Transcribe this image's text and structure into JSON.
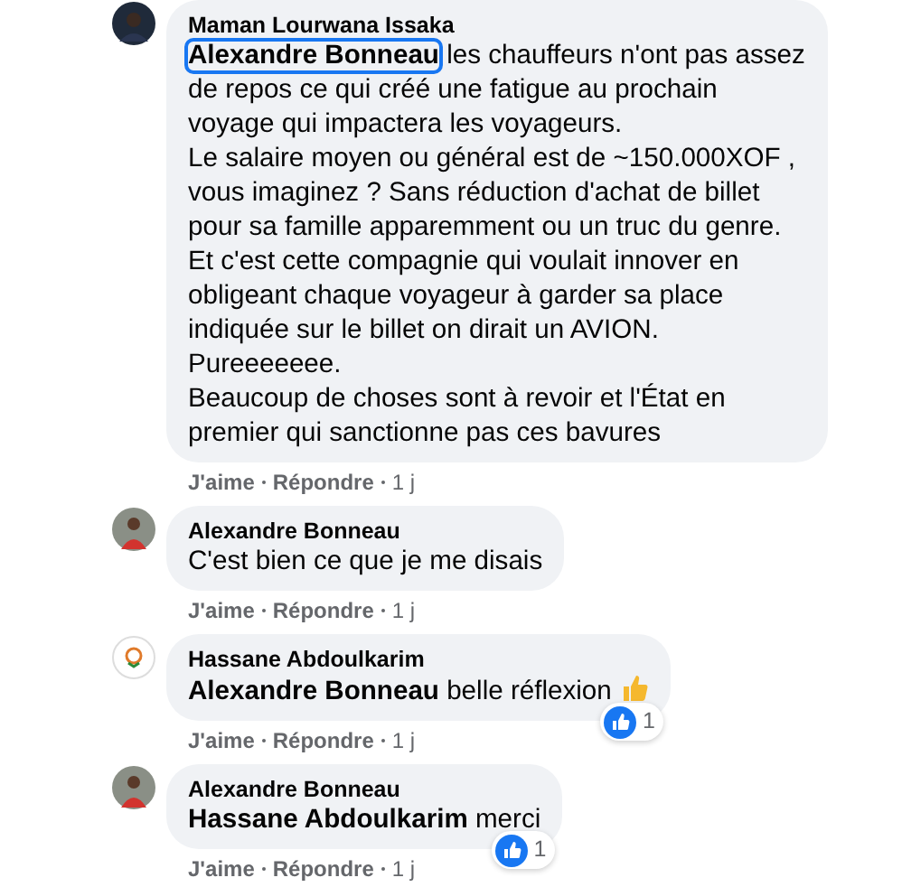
{
  "comments": [
    {
      "author": "Maman Lourwana Issaka",
      "avatar": {
        "kind": "dark"
      },
      "mention": "Alexandre Bonneau",
      "mention_focused": true,
      "text": " les chauffeurs n'ont pas assez de repos ce qui créé une fatigue au prochain voyage qui impactera les voyageurs.\nLe salaire moyen ou général est de ~150.000XOF , vous imaginez ? Sans réduction d'achat de billet pour sa famille apparemment ou un truc du genre.\nEt c'est cette compagnie qui voulait innover en obligeant chaque voyageur à garder sa place indiquée sur le billet on dirait un AVION.\nPureeeeeee.\nBeaucoup de choses sont à revoir et l'État en premier qui sanctionne pas ces bavures",
      "actions": [
        "J'aime",
        "Répondre",
        "1 j"
      ]
    },
    {
      "author": "Alexandre Bonneau",
      "avatar": {
        "kind": "red"
      },
      "text": "C'est bien ce que je me disais",
      "actions": [
        "J'aime",
        "Répondre",
        "1 j"
      ]
    },
    {
      "author": "Hassane Abdoulkarim",
      "avatar": {
        "kind": "logo"
      },
      "mention": "Alexandre Bonneau",
      "mention_focused": false,
      "text": " belle réflexion",
      "emoji": {
        "kind": "thumbs-up"
      },
      "reaction_count": "1",
      "actions": [
        "J'aime",
        "Répondre",
        "1 j"
      ]
    },
    {
      "author": "Alexandre Bonneau",
      "avatar": {
        "kind": "red"
      },
      "mention": "Hassane Abdoulkarim",
      "mention_focused": false,
      "text": " merci",
      "reaction_count": "1",
      "actions": [
        "J'aime",
        "Répondre",
        "1 j"
      ]
    }
  ]
}
